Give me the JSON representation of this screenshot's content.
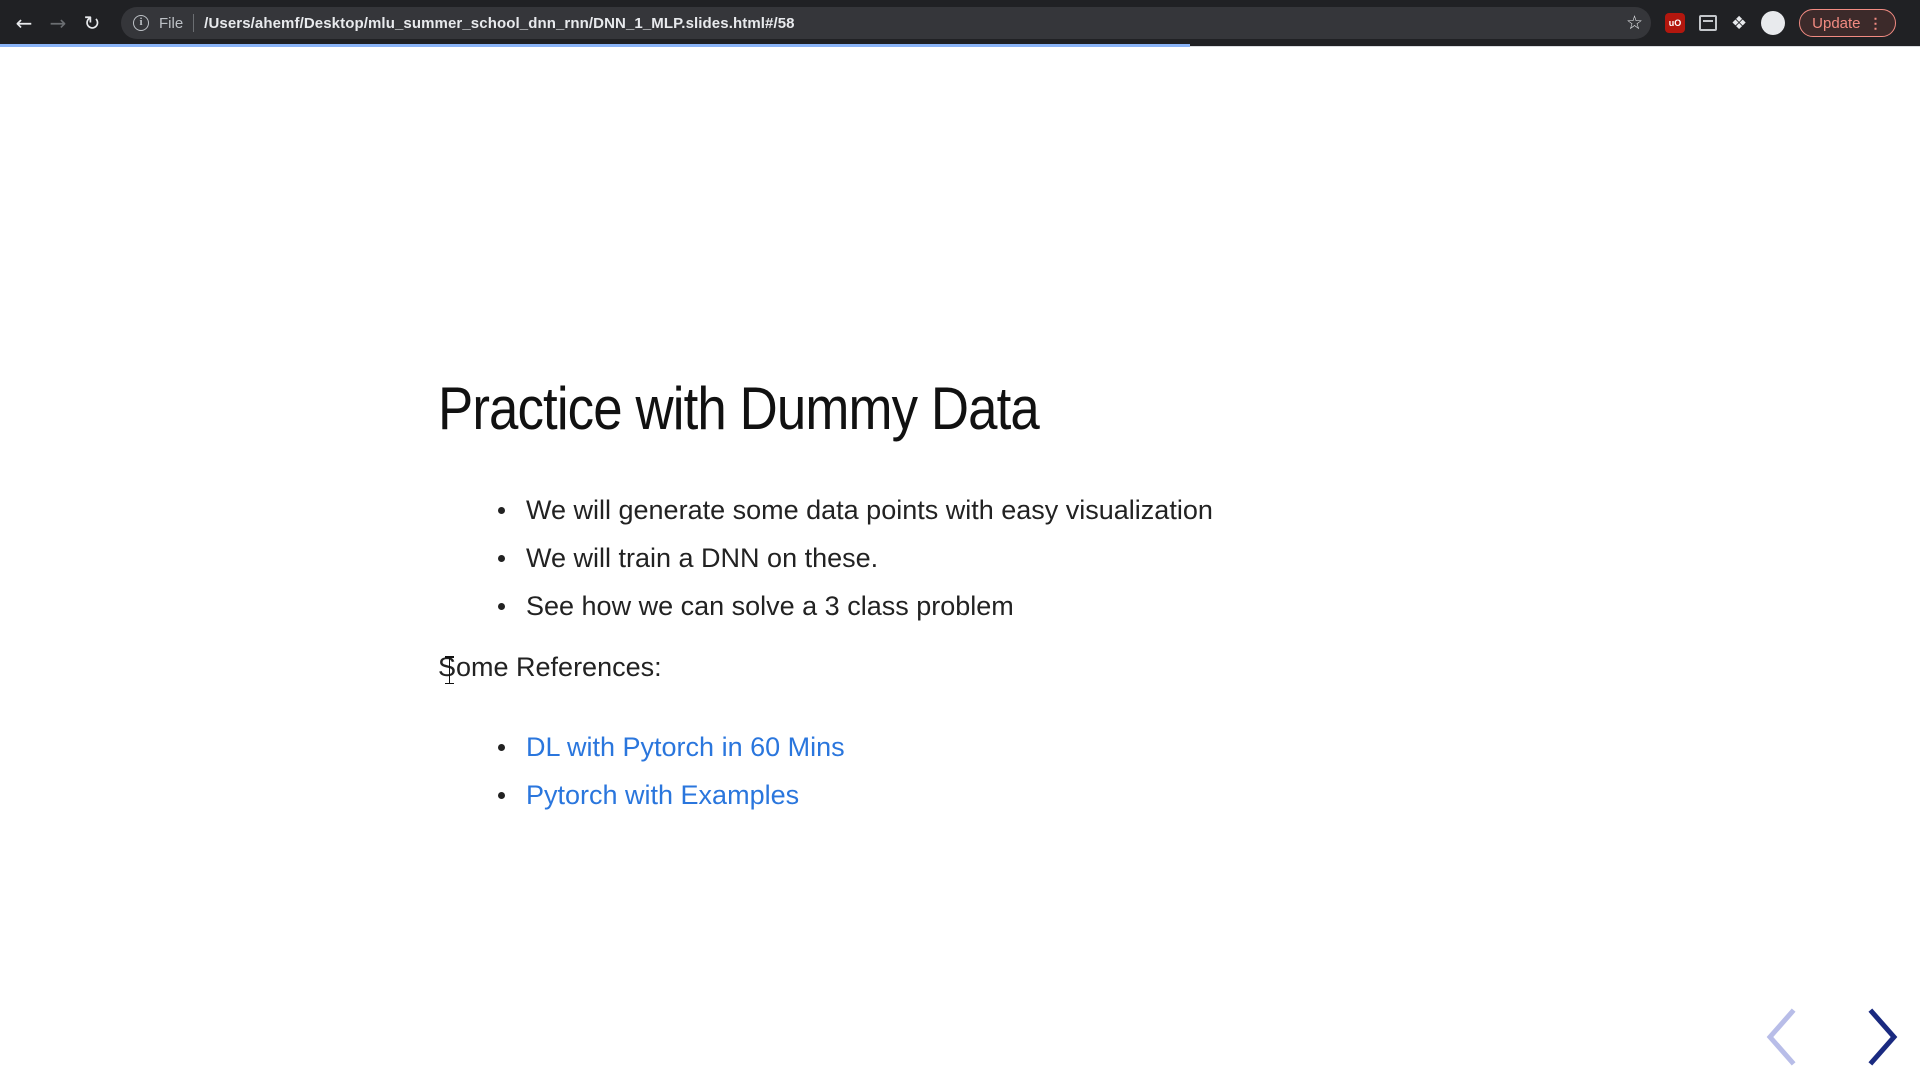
{
  "browser": {
    "nav": {
      "back_icon": "arrow-left-icon",
      "forward_icon": "arrow-right-icon",
      "reload_icon": "reload-icon"
    },
    "omnibox": {
      "scheme_label": "File",
      "url": "/Users/ahemf/Desktop/mlu_summer_school_dnn_rnn/DNN_1_MLP.slides.html#/58"
    },
    "update_label": "Update",
    "load_progress": 0.62,
    "colors": {
      "chrome_bg": "#202124",
      "omnibox_bg": "#35363a",
      "update_accent": "#f28b82"
    }
  },
  "slide": {
    "title": "Practice with Dummy Data",
    "bullets": [
      "We will generate some data points with easy visualization",
      "We will train a DNN on these.",
      "See how we can solve a 3 class problem"
    ],
    "references_heading": "Some References:",
    "references": [
      "DL with Pytorch in 60 Mins",
      "Pytorch with Examples"
    ],
    "colors": {
      "link": "#2a76dd",
      "text": "#222222",
      "next_arrow": "#1a2a80",
      "prev_arrow": "#b8bde8"
    }
  }
}
